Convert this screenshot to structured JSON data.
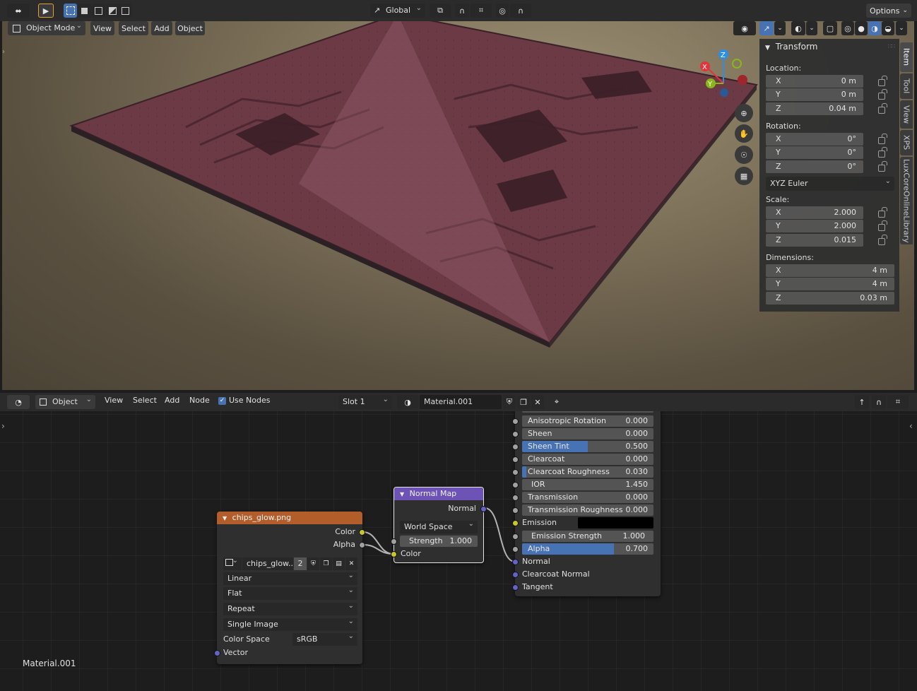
{
  "viewport": {
    "header": {
      "mode": "Object Mode",
      "menu": [
        "View",
        "Select",
        "Add",
        "Object"
      ],
      "orientation": "Global",
      "options": "Options"
    },
    "panel": {
      "title": "Transform",
      "location_label": "Location:",
      "location": [
        {
          "axis": "X",
          "value": "0 m"
        },
        {
          "axis": "Y",
          "value": "0 m"
        },
        {
          "axis": "Z",
          "value": "0.04 m"
        }
      ],
      "rotation_label": "Rotation:",
      "rotation": [
        {
          "axis": "X",
          "value": "0°"
        },
        {
          "axis": "Y",
          "value": "0°"
        },
        {
          "axis": "Z",
          "value": "0°"
        }
      ],
      "rotation_mode": "XYZ Euler",
      "scale_label": "Scale:",
      "scale": [
        {
          "axis": "X",
          "value": "2.000"
        },
        {
          "axis": "Y",
          "value": "2.000"
        },
        {
          "axis": "Z",
          "value": "0.015"
        }
      ],
      "dimensions_label": "Dimensions:",
      "dimensions": [
        {
          "axis": "X",
          "value": "4 m"
        },
        {
          "axis": "Y",
          "value": "4 m"
        },
        {
          "axis": "Z",
          "value": "0.03 m"
        }
      ]
    },
    "side_tabs": [
      "Item",
      "Tool",
      "View",
      "XPS",
      "LuxCoreOnlineLibrary"
    ],
    "gizmo": {
      "z": "Z",
      "x": "X",
      "y": "Y"
    },
    "colors": {
      "gizmo_x": "#e5333c",
      "gizmo_y": "#8ab61a",
      "gizmo_z": "#2c8fe6"
    }
  },
  "node_editor": {
    "header": {
      "type": "Object",
      "menu": [
        "View",
        "Select",
        "Add",
        "Node"
      ],
      "use_nodes": "Use Nodes",
      "slot": "Slot 1",
      "material": "Material.001"
    },
    "footer_label": "Material.001",
    "image_node": {
      "title": "chips_glow.png",
      "outputs": [
        "Color",
        "Alpha"
      ],
      "image_name": "chips_glow....",
      "users": "2",
      "interpolation": "Linear",
      "projection": "Flat",
      "extension": "Repeat",
      "source": "Single Image",
      "color_space_label": "Color Space",
      "color_space": "sRGB",
      "input": "Vector"
    },
    "normal_map_node": {
      "title": "Normal Map",
      "output": "Normal",
      "space": "World Space",
      "strength_label": "Strength",
      "strength": "1.000",
      "input": "Color"
    },
    "bsdf_node": {
      "rows": [
        {
          "label": "Anisotropic Rotation",
          "value": "0.000",
          "fill": 0
        },
        {
          "label": "Sheen",
          "value": "0.000",
          "fill": 0
        },
        {
          "label": "Sheen Tint",
          "value": "0.500",
          "fill": 0.5
        },
        {
          "label": "Clearcoat",
          "value": "0.000",
          "fill": 0
        },
        {
          "label": "Clearcoat Roughness",
          "value": "0.030",
          "fill": 0.03
        },
        {
          "label": "IOR",
          "value": "1.450",
          "fill": 0
        },
        {
          "label": "Transmission",
          "value": "0.000",
          "fill": 0
        },
        {
          "label": "Transmission Roughness",
          "value": "0.000",
          "fill": 0
        }
      ],
      "emission_label": "Emission",
      "emission_strength_label": "Emission Strength",
      "emission_strength": "1.000",
      "alpha_label": "Alpha",
      "alpha": "0.700",
      "alpha_fill": 0.7,
      "inputs": [
        "Normal",
        "Clearcoat Normal",
        "Tangent"
      ]
    }
  }
}
